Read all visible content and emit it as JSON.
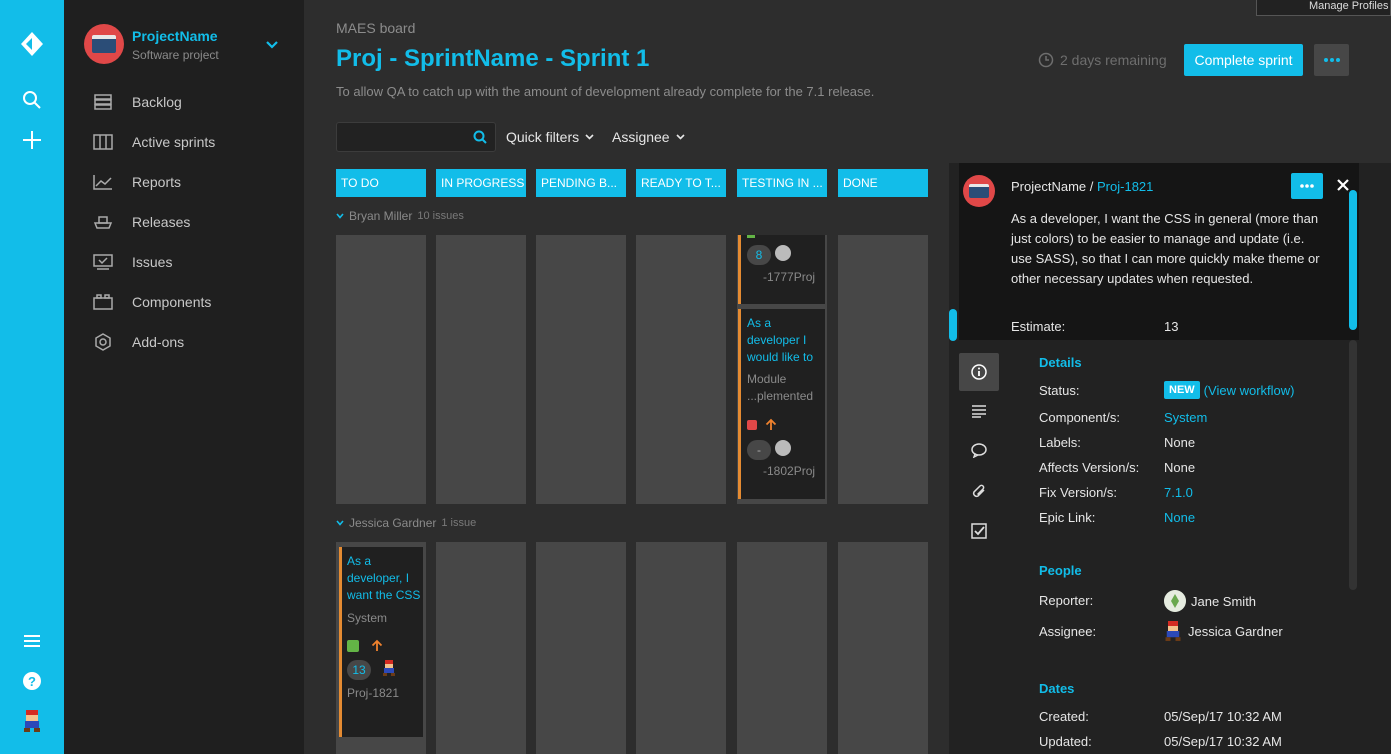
{
  "rail": {
    "icons": [
      "jira-logo-icon",
      "search-icon",
      "plus-icon",
      "menu-icon",
      "help-icon",
      "user-avatar-icon"
    ]
  },
  "project": {
    "name": "ProjectName",
    "type": "Software project"
  },
  "nav": [
    {
      "label": "Backlog",
      "icon": "backlog-icon"
    },
    {
      "label": "Active sprints",
      "icon": "active-sprints-icon"
    },
    {
      "label": "Reports",
      "icon": "reports-icon"
    },
    {
      "label": "Releases",
      "icon": "releases-icon"
    },
    {
      "label": "Issues",
      "icon": "issues-icon"
    },
    {
      "label": "Components",
      "icon": "components-icon"
    },
    {
      "label": "Add-ons",
      "icon": "add-ons-icon"
    }
  ],
  "header": {
    "board_name": "MAES board",
    "sprint_title": "Proj - SprintName - Sprint 1",
    "sprint_desc": "To allow QA to catch up with the amount of development already complete for the 7.1 release.",
    "remaining": "2 days remaining",
    "complete_label": "Complete sprint"
  },
  "filters": {
    "search_placeholder": "",
    "quick": "Quick filters",
    "assignee": "Assignee"
  },
  "columns": [
    "TO DO",
    "IN PROGRESS",
    "PENDING B...",
    "READY TO T...",
    "TESTING IN ...",
    "DONE"
  ],
  "swimlanes": [
    {
      "name": "Bryan Miller",
      "count": "10 issues"
    },
    {
      "name": "Jessica Gardner",
      "count": "1 issue"
    }
  ],
  "cards": {
    "top": {
      "estimate": "8",
      "key": "-1777Proj"
    },
    "b2": {
      "title": "As a developer I would like to",
      "component": "Module ...plemented",
      "estimate": "-",
      "key": "-1802Proj"
    },
    "j1": {
      "title": "As a developer, I want the CSS",
      "component": "System",
      "estimate": "13",
      "key": "Proj-1821"
    }
  },
  "detail": {
    "project": "ProjectName",
    "sep": "/",
    "key": "Proj-1821",
    "summary": "As a developer, I want the CSS in general (more than just colors) to be easier to manage and update (i.e. use SASS), so that I can more quickly make theme or other necessary updates when requested.",
    "estimate_label": "Estimate:",
    "estimate": "13",
    "details_title": "Details",
    "fields": {
      "status_label": "Status:",
      "status": "NEW",
      "workflow_open": "(",
      "workflow": "View workflow",
      "workflow_close": ")",
      "component_label": "Component/s:",
      "component": "System",
      "labels_label": "Labels:",
      "labels": "None",
      "affects_label": "Affects Version/s:",
      "affects": "None",
      "fix_label": "Fix Version/s:",
      "fix": "7.1.0",
      "epic_label": "Epic Link:",
      "epic": "None"
    },
    "people_title": "People",
    "reporter_label": "Reporter:",
    "reporter": "Jane Smith",
    "assignee_label": "Assignee:",
    "assignee": "Jessica Gardner",
    "dates_title": "Dates",
    "created_label": "Created:",
    "created": "05/Sep/17 10:32 AM",
    "updated_label": "Updated:",
    "updated": "05/Sep/17 10:32 AM"
  },
  "overlay": {
    "manage_profiles": "Manage Profiles"
  },
  "colors": {
    "accent": "#12bde9",
    "card_border": "#e58b32",
    "priority": "#f0822e",
    "story": "#63b446"
  }
}
